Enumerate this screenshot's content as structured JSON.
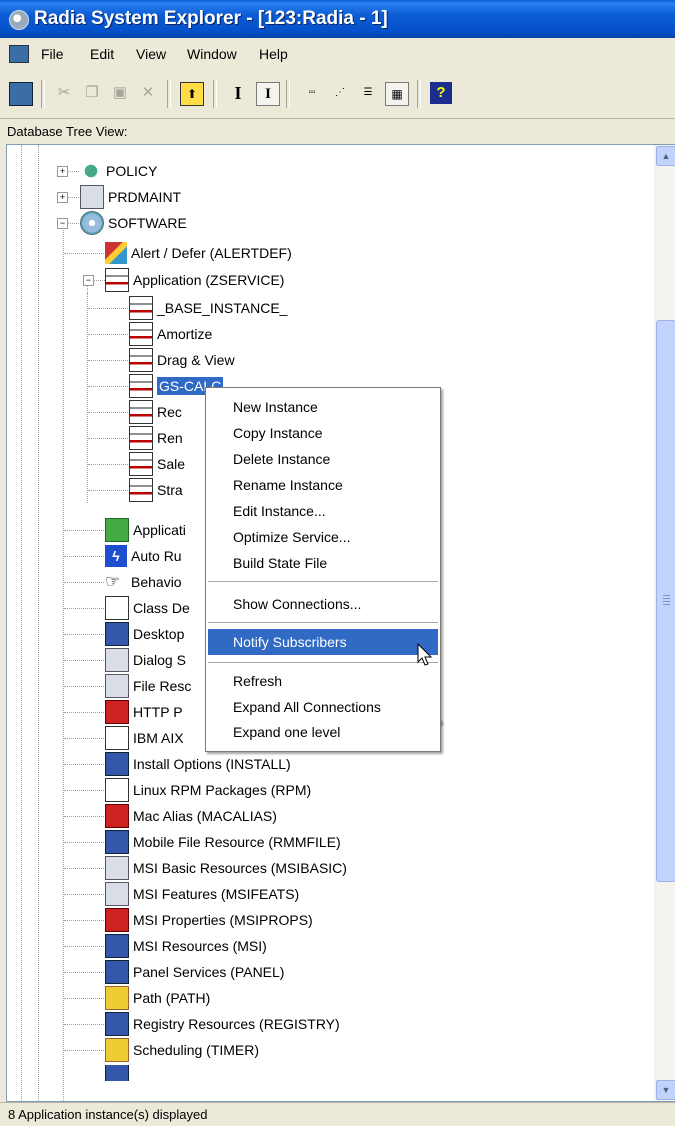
{
  "window": {
    "title": "Radia System Explorer - [123:Radia - 1]"
  },
  "menubar": {
    "items": [
      "File",
      "Edit",
      "View",
      "Window",
      "Help"
    ]
  },
  "panel": {
    "label": "Database Tree View:"
  },
  "tree": {
    "top_items": [
      "POLICY",
      "PRDMAINT",
      "SOFTWARE"
    ],
    "software_children": {
      "alertdef": "Alert / Defer (ALERTDEF)",
      "zservice": "Application (ZSERVICE)",
      "instances": [
        "_BASE_INSTANCE_",
        "Amortize",
        "Drag & View",
        "GS-CALC",
        "Rec",
        "Ren",
        "Sale",
        "Stra"
      ],
      "partial": [
        "Applicati",
        "Auto Ru",
        "Behavio",
        "Class De",
        "Desktop",
        "Dialog S",
        "File Resc",
        "HTTP P",
        "IBM AIX"
      ],
      "full": [
        "Install Options (INSTALL)",
        "Linux RPM Packages (RPM)",
        "Mac Alias (MACALIAS)",
        "Mobile File Resource (RMMFILE)",
        "MSI Basic Resources (MSIBASIC)",
        "MSI Features (MSIFEATS)",
        "MSI Properties (MSIPROPS)",
        "MSI Resources (MSI)",
        "Panel Services (PANEL)",
        "Path (PATH)",
        "Registry Resources (REGISTRY)",
        "Scheduling (TIMER)"
      ]
    }
  },
  "context_menu": {
    "group1": [
      "New Instance",
      "Copy Instance",
      "Delete Instance",
      "Rename Instance",
      "Edit Instance...",
      "Optimize Service...",
      "Build State File"
    ],
    "group2": [
      "Show Connections..."
    ],
    "group3": [
      "Notify Subscribers"
    ],
    "group4": [
      "Refresh",
      "Expand All Connections",
      "Expand one level"
    ],
    "highlighted": "Notify Subscribers"
  },
  "status": {
    "text": "8 Application instance(s) displayed"
  },
  "colors": {
    "titlebar": "#0553C8",
    "selection": "#316AC5",
    "menu_highlight": "#316AC5"
  }
}
